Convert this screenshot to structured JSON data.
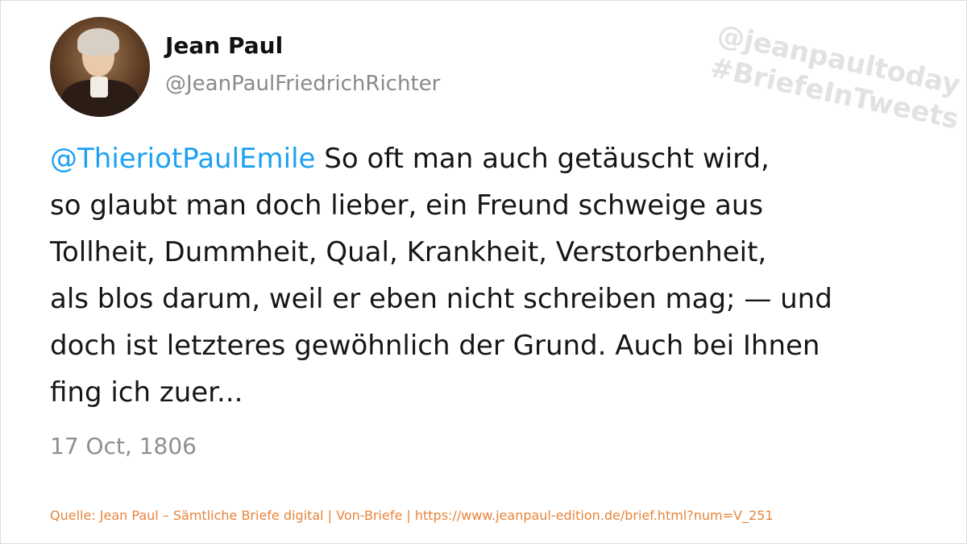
{
  "author": {
    "name": "Jean Paul",
    "handle": "@JeanPaulFriedrichRichter"
  },
  "watermark": {
    "line1": "@jeanpaultoday",
    "line2": "#BriefeInTweets"
  },
  "tweet": {
    "mention": "@ThieriotPaulEmile",
    "lines": [
      " So oft man auch getäuscht wird,",
      "so glaubt man doch lieber, ein Freund schweige aus",
      "Tollheit, Dummheit, Qual, Krankheit, Verstorbenheit,",
      "als blos darum, weil er eben nicht schreiben mag; — und",
      "doch ist letzteres gewöhnlich der Grund. Auch bei Ihnen",
      "fing ich zuer..."
    ]
  },
  "date": "17 Oct, 1806",
  "source": "Quelle: Jean Paul – Sämtliche Briefe digital | Von-Briefe | https://www.jeanpaul-edition.de/brief.html?num=V_251",
  "colors": {
    "mention": "#1da1f2",
    "source": "#e8843a",
    "watermark": "#e2e2e2"
  }
}
